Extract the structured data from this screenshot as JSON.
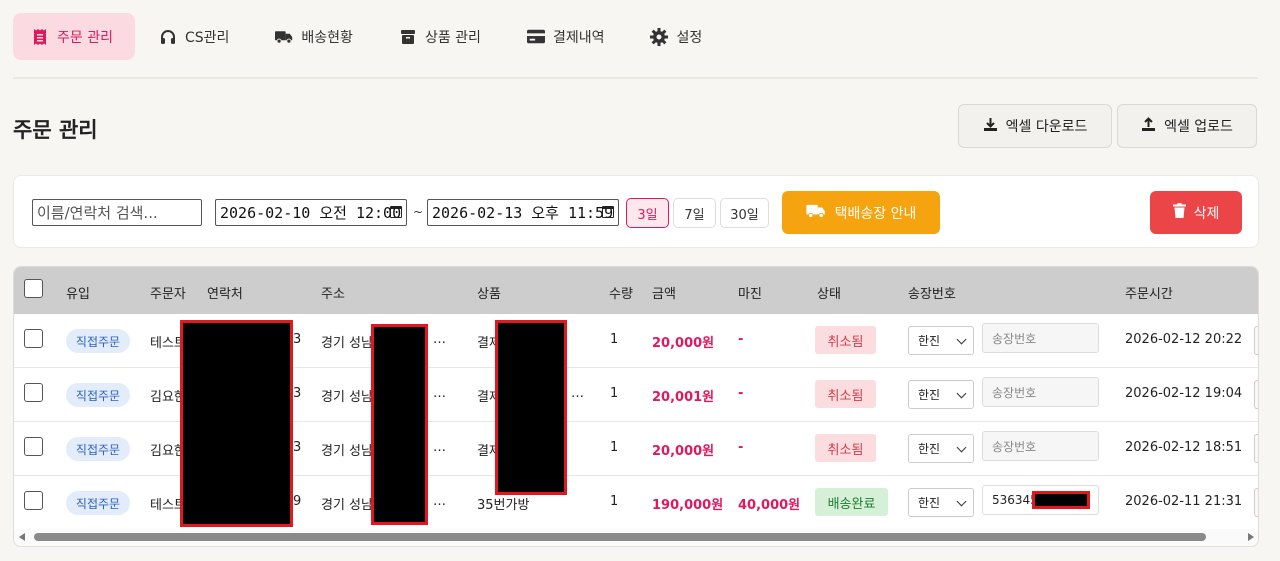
{
  "nav": {
    "items": [
      {
        "label": "주문 관리",
        "icon": "receipt-icon"
      },
      {
        "label": "CS관리",
        "icon": "headset-icon"
      },
      {
        "label": "배송현황",
        "icon": "truck-icon"
      },
      {
        "label": "상품 관리",
        "icon": "box-icon"
      },
      {
        "label": "결제내역",
        "icon": "credit-card-icon"
      },
      {
        "label": "설정",
        "icon": "gear-icon"
      }
    ],
    "active_index": 0
  },
  "page": {
    "title": "주문 관리",
    "excel_download": "엑셀 다운로드",
    "excel_upload": "엑셀 업로드"
  },
  "filter": {
    "search_placeholder": "이름/연락처 검색...",
    "date_from": "2026-02-10 오전 12:00",
    "date_to": "2026-02-13 오후 11:59",
    "tilde": "~",
    "range_buttons": [
      "3일",
      "7일",
      "30일"
    ],
    "active_range": "3일",
    "courier_button": "택배송장 안내",
    "delete_button": "삭제"
  },
  "table": {
    "headers": [
      "유입",
      "주문자",
      "연락처",
      "주소",
      "상품",
      "수량",
      "금액",
      "마진",
      "상태",
      "송장번호",
      "주문시간"
    ],
    "rows": [
      {
        "source": "직접주문",
        "customer": "테스트",
        "phone_tail": "3",
        "address": "경기 성남",
        "ellipsis": "…",
        "product": "결제",
        "product_more": "",
        "qty": "1",
        "amount": "20,000원",
        "margin": "-",
        "status": "취소됨",
        "status_type": "cancel",
        "carrier": "한진",
        "tracking": "송장번호",
        "tracking_filled": false,
        "time": "2026-02-12 20:22"
      },
      {
        "source": "직접주문",
        "customer": "김요한",
        "phone_tail": "3",
        "address": "경기 성남",
        "ellipsis": "…",
        "product": "결제",
        "product_more": "…",
        "qty": "1",
        "amount": "20,001원",
        "margin": "-",
        "status": "취소됨",
        "status_type": "cancel",
        "carrier": "한진",
        "tracking": "송장번호",
        "tracking_filled": false,
        "time": "2026-02-12 19:04"
      },
      {
        "source": "직접주문",
        "customer": "김요한",
        "phone_tail": "3",
        "address": "경기 성남",
        "ellipsis": "…",
        "product": "결제",
        "product_more": "",
        "qty": "1",
        "amount": "20,000원",
        "margin": "-",
        "status": "취소됨",
        "status_type": "cancel",
        "carrier": "한진",
        "tracking": "송장번호",
        "tracking_filled": false,
        "time": "2026-02-12 18:51"
      },
      {
        "source": "직접주문",
        "customer": "테스트",
        "phone_tail": "9",
        "address": "경기 성남",
        "ellipsis": "…",
        "product": "35번가방",
        "product_more": "",
        "qty": "1",
        "amount": "190,000원",
        "margin": "40,000원",
        "status": "배송완료",
        "status_type": "done",
        "carrier": "한진",
        "tracking": "536345",
        "tracking_filled": true,
        "time": "2026-02-11 21:31"
      }
    ]
  },
  "colors": {
    "accent": "#e0195f",
    "courier": "#f5a30e",
    "delete": "#ec4548",
    "redaction_border": "#e0191f"
  }
}
